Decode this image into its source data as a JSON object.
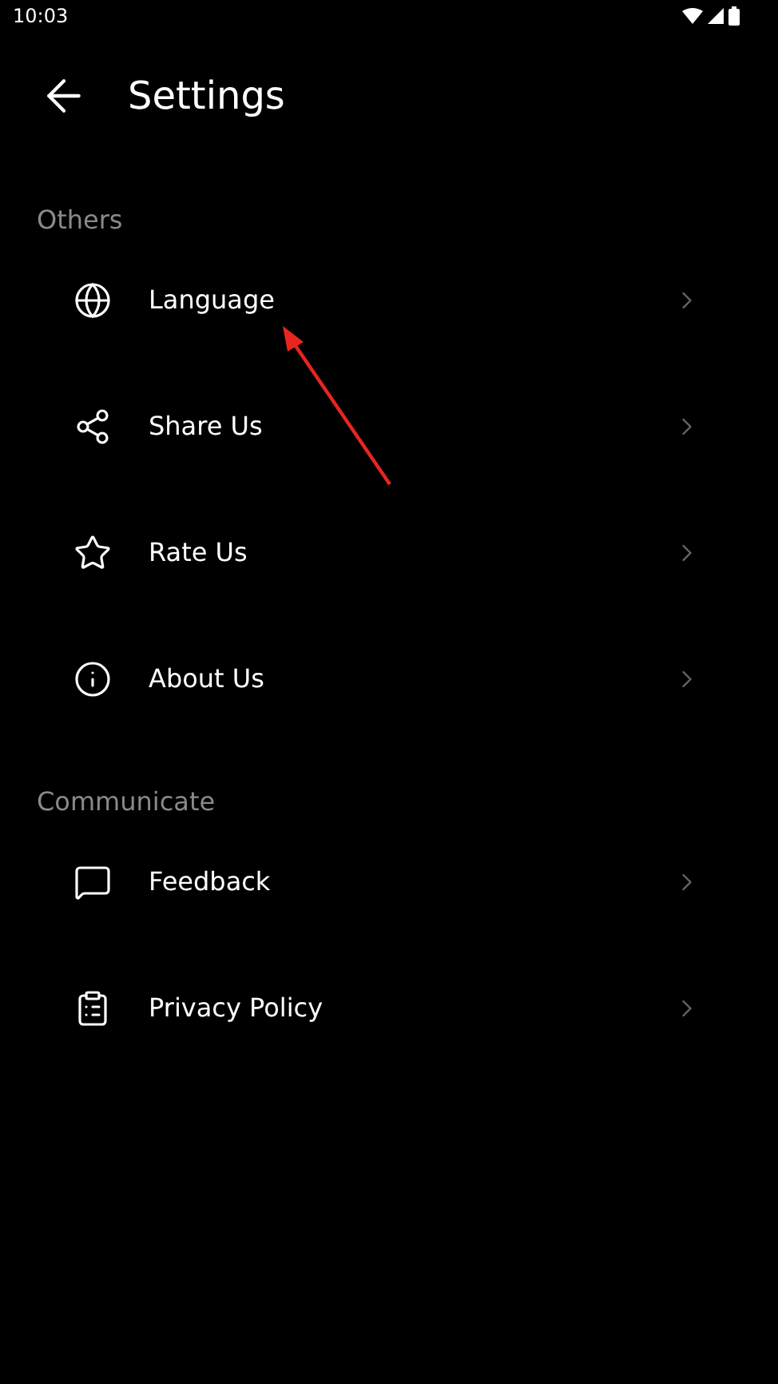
{
  "status_bar": {
    "time": "10:03"
  },
  "header": {
    "title": "Settings"
  },
  "sections": [
    {
      "title": "Others",
      "items": [
        {
          "label": "Language"
        },
        {
          "label": "Share Us"
        },
        {
          "label": "Rate Us"
        },
        {
          "label": "About Us"
        }
      ]
    },
    {
      "title": "Communicate",
      "items": [
        {
          "label": "Feedback"
        },
        {
          "label": "Privacy Policy"
        }
      ]
    }
  ]
}
